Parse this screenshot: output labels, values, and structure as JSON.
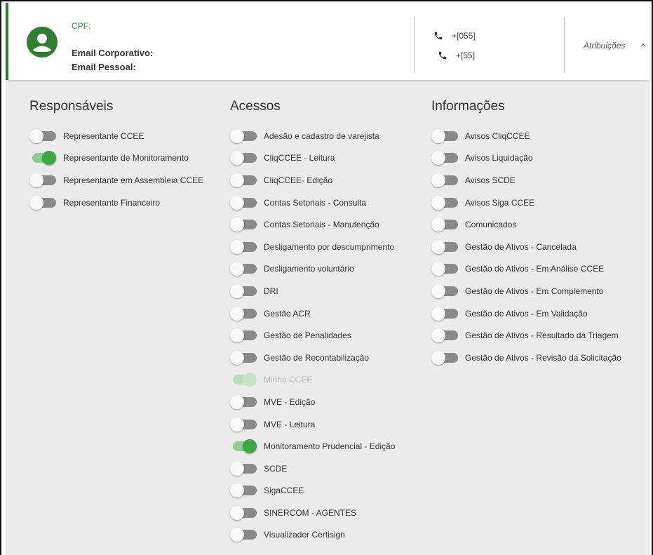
{
  "header": {
    "cpf_label": "CPF:",
    "email_corporativo_label": "Email Corporativo:",
    "email_pessoal_label": "Email Pessoal:",
    "phones": [
      "+[055]",
      "+[55]"
    ],
    "atribuicoes_label": "Atribuições",
    "accent_color": "#2e7d32"
  },
  "columns": [
    {
      "title": "Responsáveis",
      "items": [
        {
          "label": "Representante CCEE",
          "state": "off"
        },
        {
          "label": "Representante de Monitoramento",
          "state": "on"
        },
        {
          "label": "Representante em Assembleia CCEE",
          "state": "off"
        },
        {
          "label": "Representante Financeiro",
          "state": "off"
        }
      ]
    },
    {
      "title": "Acessos",
      "items": [
        {
          "label": "Adesão e cadastro de varejista",
          "state": "off"
        },
        {
          "label": "CliqCCEE - Leitura",
          "state": "off"
        },
        {
          "label": "CliqCCEE- Edição",
          "state": "off"
        },
        {
          "label": "Contas Setoriais - Consulta",
          "state": "off"
        },
        {
          "label": "Contas Setoriais - Manutenção",
          "state": "off"
        },
        {
          "label": "Desligamento por descumprimento",
          "state": "off"
        },
        {
          "label": "Desligamento voluntário",
          "state": "off"
        },
        {
          "label": "DRI",
          "state": "off"
        },
        {
          "label": "Gestão ACR",
          "state": "off"
        },
        {
          "label": "Gestão de Penalidades",
          "state": "off"
        },
        {
          "label": "Gestão de Recontabilização",
          "state": "off"
        },
        {
          "label": "Minha CCEE",
          "state": "disabled"
        },
        {
          "label": "MVE - Edição",
          "state": "off"
        },
        {
          "label": "MVE - Leitura",
          "state": "off"
        },
        {
          "label": "Monitoramento Prudencial - Edição",
          "state": "on"
        },
        {
          "label": "SCDE",
          "state": "off"
        },
        {
          "label": "SigaCCEE",
          "state": "off"
        },
        {
          "label": "SINERCOM - AGENTES",
          "state": "off"
        },
        {
          "label": "Visualizador Certisign",
          "state": "off"
        }
      ]
    },
    {
      "title": "Informações",
      "items": [
        {
          "label": "Avisos CliqCCEE",
          "state": "off"
        },
        {
          "label": "Avisos Liquidação",
          "state": "off"
        },
        {
          "label": "Avisos SCDE",
          "state": "off"
        },
        {
          "label": "Avisos Siga CCEE",
          "state": "off"
        },
        {
          "label": "Comunicados",
          "state": "off"
        },
        {
          "label": "Gestão de Ativos - Cancelada",
          "state": "off"
        },
        {
          "label": "Gestão de Ativos - Em Análise CCEE",
          "state": "off"
        },
        {
          "label": "Gestão de Ativos - Em Complemento",
          "state": "off"
        },
        {
          "label": "Gestão de Ativos - Em Validação",
          "state": "off"
        },
        {
          "label": "Gestão de Ativos - Resultado da Triagem",
          "state": "off"
        },
        {
          "label": "Gestão de Ativos - Revisão da Solicitação",
          "state": "off"
        }
      ]
    }
  ]
}
